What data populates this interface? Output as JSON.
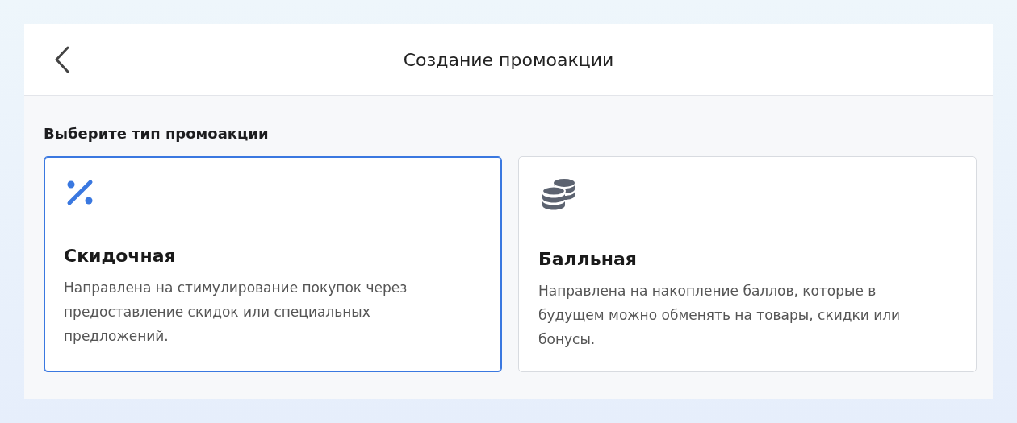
{
  "header": {
    "title": "Создание промоакции"
  },
  "section_title": "Выберите тип промоакции",
  "options": [
    {
      "kind": "percent",
      "title": "Скидочная",
      "description": "Направлена на стимулирование покупок через предоставление скидок или специальных предложений.",
      "selected": true
    },
    {
      "kind": "coins",
      "title": "Балльная",
      "description": "Направлена на накопление баллов, которые в будущем можно обменять на товары, скидки или бонусы.",
      "selected": false
    }
  ]
}
